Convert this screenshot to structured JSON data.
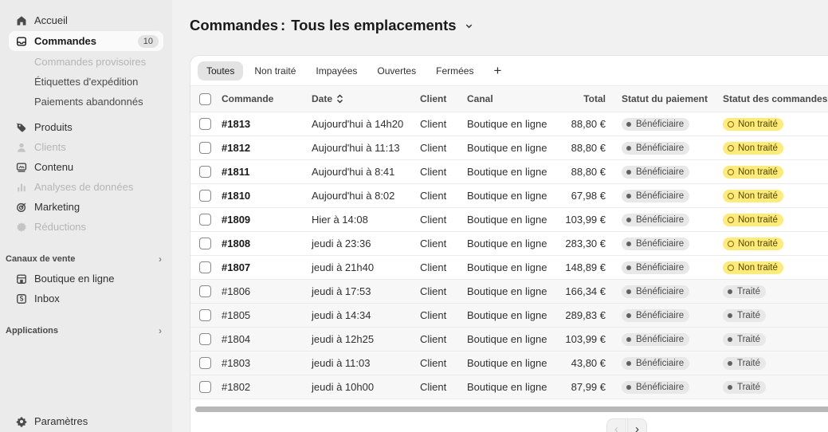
{
  "sidebar": {
    "nav": [
      {
        "label": "Accueil",
        "icon": "home-icon"
      },
      {
        "label": "Commandes",
        "icon": "inbox-icon",
        "badge": "10"
      },
      {
        "label": "Produits",
        "icon": "tag-icon"
      },
      {
        "label": "Clients",
        "icon": "person-icon"
      },
      {
        "label": "Contenu",
        "icon": "content-icon"
      },
      {
        "label": "Analyses de données",
        "icon": "bar-chart-icon"
      },
      {
        "label": "Marketing",
        "icon": "target-icon"
      },
      {
        "label": "Réductions",
        "icon": "discount-icon"
      }
    ],
    "subnav": [
      "Commandes provisoires",
      "Étiquettes d'expédition",
      "Paiements abandonnés"
    ],
    "sales_channels": {
      "title": "Canaux de vente",
      "items": [
        {
          "label": "Boutique en ligne",
          "icon": "store-icon"
        },
        {
          "label": "Inbox",
          "icon": "chat-icon"
        }
      ]
    },
    "apps": {
      "title": "Applications"
    },
    "settings": {
      "label": "Paramètres",
      "icon": "gear-icon"
    }
  },
  "header": {
    "title": "Commandes",
    "separator": ":",
    "location": "Tous les emplacements"
  },
  "tabs": [
    "Toutes",
    "Non traité",
    "Impayées",
    "Ouvertes",
    "Fermées"
  ],
  "table": {
    "columns": {
      "order": "Commande",
      "date": "Date",
      "client": "Client",
      "canal": "Canal",
      "total": "Total",
      "payment": "Statut du paiement",
      "status": "Statut des commandes"
    },
    "rows": [
      {
        "order": "#1813",
        "date": "Aujourd'hui à 14h20",
        "client": "Client",
        "canal": "Boutique en ligne",
        "total": "88,80 €",
        "payment": "Bénéficiaire",
        "status": "Non traité"
      },
      {
        "order": "#1812",
        "date": "Aujourd'hui à 11:13",
        "client": "Client",
        "canal": "Boutique en ligne",
        "total": "88,80 €",
        "payment": "Bénéficiaire",
        "status": "Non traité"
      },
      {
        "order": "#1811",
        "date": "Aujourd'hui à 8:41",
        "client": "Client",
        "canal": "Boutique en ligne",
        "total": "88,80 €",
        "payment": "Bénéficiaire",
        "status": "Non traité"
      },
      {
        "order": "#1810",
        "date": "Aujourd'hui à 8:02",
        "client": "Client",
        "canal": "Boutique en ligne",
        "total": "67,98 €",
        "payment": "Bénéficiaire",
        "status": "Non traité"
      },
      {
        "order": "#1809",
        "date": "Hier à 14:08",
        "client": "Client",
        "canal": "Boutique en ligne",
        "total": "103,99 €",
        "payment": "Bénéficiaire",
        "status": "Non traité"
      },
      {
        "order": "#1808",
        "date": "jeudi à 23:36",
        "client": "Client",
        "canal": "Boutique en ligne",
        "total": "283,30 €",
        "payment": "Bénéficiaire",
        "status": "Non traité"
      },
      {
        "order": "#1807",
        "date": "jeudi à 21h40",
        "client": "Client",
        "canal": "Boutique en ligne",
        "total": "148,89 €",
        "payment": "Bénéficiaire",
        "status": "Non traité"
      },
      {
        "order": "#1806",
        "date": "jeudi à 17:53",
        "client": "Client",
        "canal": "Boutique en ligne",
        "total": "166,34 €",
        "payment": "Bénéficiaire",
        "status": "Traité"
      },
      {
        "order": "#1805",
        "date": "jeudi à 14:34",
        "client": "Client",
        "canal": "Boutique en ligne",
        "total": "289,83 €",
        "payment": "Bénéficiaire",
        "status": "Traité"
      },
      {
        "order": "#1804",
        "date": "jeudi à 12h25",
        "client": "Client",
        "canal": "Boutique en ligne",
        "total": "103,99 €",
        "payment": "Bénéficiaire",
        "status": "Traité"
      },
      {
        "order": "#1803",
        "date": "jeudi à 11:03",
        "client": "Client",
        "canal": "Boutique en ligne",
        "total": "43,80 €",
        "payment": "Bénéficiaire",
        "status": "Traité"
      },
      {
        "order": "#1802",
        "date": "jeudi à 10h00",
        "client": "Client",
        "canal": "Boutique en ligne",
        "total": "87,99 €",
        "payment": "Bénéficiaire",
        "status": "Traité"
      }
    ]
  },
  "colors": {
    "sidebar_bg": "#ebebeb",
    "page_bg": "#f1f1f1",
    "unfulfilled_badge": "#ffeb78",
    "neutral_badge": "#e8e8e8"
  }
}
